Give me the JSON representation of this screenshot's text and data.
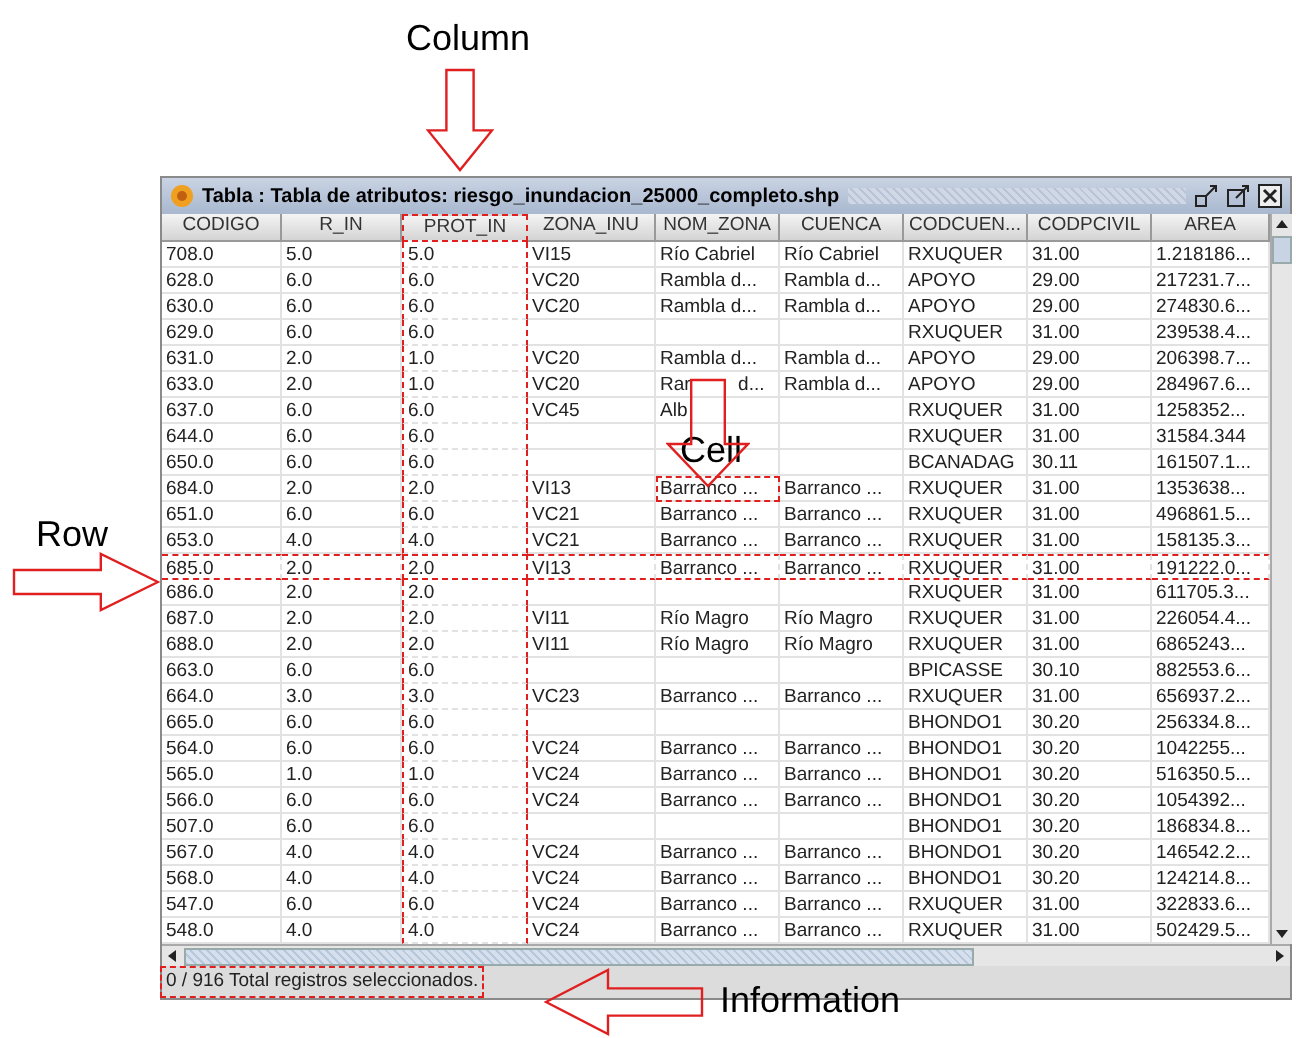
{
  "annotations": {
    "column_label": "Column",
    "row_label": "Row",
    "cell_label": "Cell",
    "info_label": "Information"
  },
  "window": {
    "title": "Tabla : Tabla de atributos: riesgo_inundacion_25000_completo.shp"
  },
  "table": {
    "columns": [
      {
        "label": "CODIGO",
        "highlighted": false
      },
      {
        "label": "R_IN",
        "highlighted": false
      },
      {
        "label": "PROT_IN",
        "highlighted": true
      },
      {
        "label": "ZONA_INU",
        "highlighted": false
      },
      {
        "label": "NOM_ZONA",
        "highlighted": false
      },
      {
        "label": "CUENCA",
        "highlighted": false
      },
      {
        "label": "CODCUEN...",
        "highlighted": false
      },
      {
        "label": "CODPCIVIL",
        "highlighted": false
      },
      {
        "label": "AREA",
        "highlighted": false
      }
    ],
    "rows": [
      {
        "highlighted": false,
        "cells": [
          "708.0",
          "5.0",
          "5.0",
          "VI15",
          "Río Cabriel",
          "Río Cabriel",
          "RXUQUER",
          "31.00",
          "1.218186..."
        ]
      },
      {
        "highlighted": false,
        "cells": [
          "628.0",
          "6.0",
          "6.0",
          "VC20",
          "Rambla d...",
          "Rambla d...",
          "APOYO",
          "29.00",
          "217231.7..."
        ]
      },
      {
        "highlighted": false,
        "cells": [
          "630.0",
          "6.0",
          "6.0",
          "VC20",
          "Rambla d...",
          "Rambla d...",
          "APOYO",
          "29.00",
          "274830.6..."
        ]
      },
      {
        "highlighted": false,
        "cells": [
          "629.0",
          "6.0",
          "6.0",
          "",
          "",
          "",
          "RXUQUER",
          "31.00",
          "239538.4..."
        ]
      },
      {
        "highlighted": false,
        "cells": [
          "631.0",
          "2.0",
          "1.0",
          "VC20",
          "Rambla d...",
          "Rambla d...",
          "APOYO",
          "29.00",
          "206398.7..."
        ]
      },
      {
        "highlighted": false,
        "cells": [
          "633.0",
          "2.0",
          "1.0",
          "VC20",
          "Rar         d...",
          "Rambla d...",
          "APOYO",
          "29.00",
          "284967.6..."
        ]
      },
      {
        "highlighted": false,
        "cells": [
          "637.0",
          "6.0",
          "6.0",
          "VC45",
          "Alb",
          "",
          "RXUQUER",
          "31.00",
          "1258352..."
        ]
      },
      {
        "highlighted": false,
        "cells": [
          "644.0",
          "6.0",
          "6.0",
          "",
          "",
          "",
          "RXUQUER",
          "31.00",
          "31584.344"
        ]
      },
      {
        "highlighted": false,
        "cells": [
          "650.0",
          "6.0",
          "6.0",
          "",
          "",
          "",
          "BCANADAG",
          "30.11",
          "161507.1..."
        ]
      },
      {
        "highlighted": false,
        "cell_highlight": [
          false,
          false,
          false,
          false,
          true,
          false,
          false,
          false,
          false
        ],
        "cells": [
          "684.0",
          "2.0",
          "2.0",
          "VI13",
          "Barranco ...",
          "Barranco ...",
          "RXUQUER",
          "31.00",
          "1353638..."
        ]
      },
      {
        "highlighted": false,
        "cells": [
          "651.0",
          "6.0",
          "6.0",
          "VC21",
          "Barranco ...",
          "Barranco ...",
          "RXUQUER",
          "31.00",
          "496861.5..."
        ]
      },
      {
        "highlighted": false,
        "cells": [
          "653.0",
          "4.0",
          "4.0",
          "VC21",
          "Barranco ...",
          "Barranco ...",
          "RXUQUER",
          "31.00",
          "158135.3..."
        ]
      },
      {
        "highlighted": true,
        "cells": [
          "685.0",
          "2.0",
          "2.0",
          "VI13",
          "Barranco ...",
          "Barranco ...",
          "RXUQUER",
          "31.00",
          "191222.0..."
        ]
      },
      {
        "highlighted": false,
        "cells": [
          "686.0",
          "2.0",
          "2.0",
          "",
          "",
          "",
          "RXUQUER",
          "31.00",
          "611705.3..."
        ]
      },
      {
        "highlighted": false,
        "cells": [
          "687.0",
          "2.0",
          "2.0",
          "VI11",
          "Río Magro",
          "Río Magro",
          "RXUQUER",
          "31.00",
          "226054.4..."
        ]
      },
      {
        "highlighted": false,
        "cells": [
          "688.0",
          "2.0",
          "2.0",
          "VI11",
          "Río Magro",
          "Río Magro",
          "RXUQUER",
          "31.00",
          "6865243..."
        ]
      },
      {
        "highlighted": false,
        "cells": [
          "663.0",
          "6.0",
          "6.0",
          "",
          "",
          "",
          "BPICASSE",
          "30.10",
          "882553.6..."
        ]
      },
      {
        "highlighted": false,
        "cells": [
          "664.0",
          "3.0",
          "3.0",
          "VC23",
          "Barranco ...",
          "Barranco ...",
          "RXUQUER",
          "31.00",
          "656937.2..."
        ]
      },
      {
        "highlighted": false,
        "cells": [
          "665.0",
          "6.0",
          "6.0",
          "",
          "",
          "",
          "BHONDO1",
          "30.20",
          "256334.8..."
        ]
      },
      {
        "highlighted": false,
        "cells": [
          "564.0",
          "6.0",
          "6.0",
          "VC24",
          "Barranco ...",
          "Barranco ...",
          "BHONDO1",
          "30.20",
          "1042255..."
        ]
      },
      {
        "highlighted": false,
        "cells": [
          "565.0",
          "1.0",
          "1.0",
          "VC24",
          "Barranco ...",
          "Barranco ...",
          "BHONDO1",
          "30.20",
          "516350.5..."
        ]
      },
      {
        "highlighted": false,
        "cells": [
          "566.0",
          "6.0",
          "6.0",
          "VC24",
          "Barranco ...",
          "Barranco ...",
          "BHONDO1",
          "30.20",
          "1054392..."
        ]
      },
      {
        "highlighted": false,
        "cells": [
          "507.0",
          "6.0",
          "6.0",
          "",
          "",
          "",
          "BHONDO1",
          "30.20",
          "186834.8..."
        ]
      },
      {
        "highlighted": false,
        "cells": [
          "567.0",
          "4.0",
          "4.0",
          "VC24",
          "Barranco ...",
          "Barranco ...",
          "BHONDO1",
          "30.20",
          "146542.2..."
        ]
      },
      {
        "highlighted": false,
        "cells": [
          "568.0",
          "4.0",
          "4.0",
          "VC24",
          "Barranco ...",
          "Barranco ...",
          "BHONDO1",
          "30.20",
          "124214.8..."
        ]
      },
      {
        "highlighted": false,
        "cells": [
          "547.0",
          "6.0",
          "6.0",
          "VC24",
          "Barranco ...",
          "Barranco ...",
          "RXUQUER",
          "31.00",
          "322833.6..."
        ]
      },
      {
        "highlighted": false,
        "cells": [
          "548.0",
          "4.0",
          "4.0",
          "VC24",
          "Barranco ...",
          "Barranco ...",
          "RXUQUER",
          "31.00",
          "502429.5..."
        ]
      }
    ]
  },
  "status_bar": {
    "text": "0 / 916 Total registros seleccionados.",
    "highlighted": true
  }
}
